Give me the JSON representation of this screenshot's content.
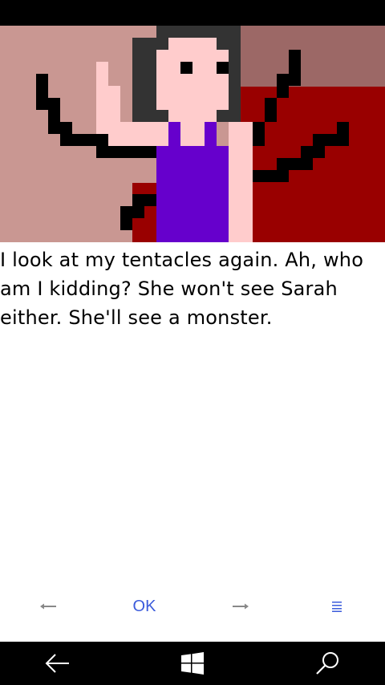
{
  "story": {
    "text": "I look at my tentacles again. Ah, who am I kidding? She won't see Sarah either. She'll see a monster."
  },
  "toolbar": {
    "back_icon": "left-arrow-icon",
    "ok_label": "OK",
    "forward_icon": "right-arrow-icon",
    "menu_icon": "menu-lines-icon"
  },
  "navbar": {
    "back_icon": "back-arrow-icon",
    "start_icon": "windows-logo-icon",
    "search_icon": "search-icon"
  },
  "colors": {
    "accent": "#3b5bdb",
    "bar": "#000000",
    "scene_wall": "#c99792",
    "scene_red": "#990000",
    "dress": "#6600cc",
    "skin": "#ffcccc",
    "hair": "#333333"
  }
}
